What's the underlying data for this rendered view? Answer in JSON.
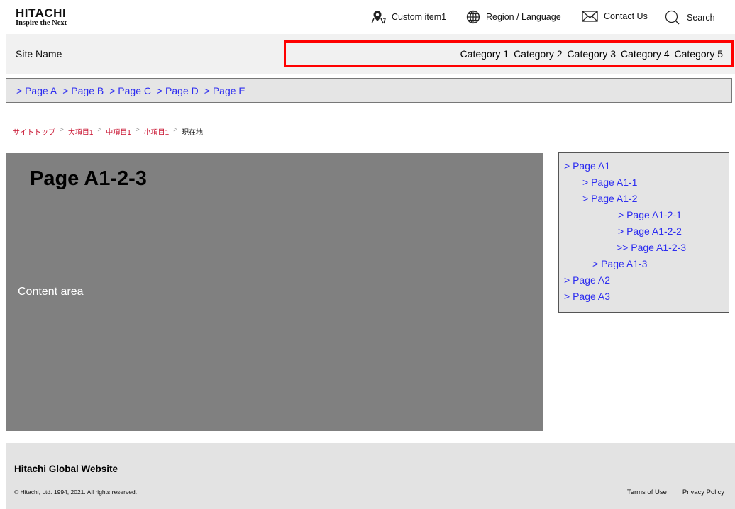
{
  "header": {
    "logo_main": "HITACHI",
    "logo_sub": "Inspire the Next",
    "utility": {
      "custom_item": "Custom item1",
      "region": "Region / Language",
      "contact": "Contact Us",
      "search": "Search"
    },
    "icons": [
      "map-pin-icon",
      "globe-icon",
      "envelope-icon",
      "search-icon"
    ]
  },
  "sitebar": {
    "site_name": "Site Name",
    "categories": [
      "Category 1",
      "Category 2",
      "Category 3",
      "Category 4",
      "Category 5"
    ],
    "highlight_color": "#ff0000"
  },
  "subnav": {
    "items": [
      "> Page A",
      "> Page B",
      "> Page C",
      "> Page D",
      "> Page E"
    ],
    "link_color": "#2d2df0"
  },
  "breadcrumb": {
    "items": [
      "サイトトップ",
      "大項目1",
      "中項目1",
      "小項目1"
    ],
    "separator": ">",
    "current": "現在地",
    "link_color": "#c8102e"
  },
  "content": {
    "title": "Page A1-2-3",
    "label": "Content area",
    "background": "#808080"
  },
  "sidenav": {
    "items": [
      {
        "label": "> Page A1",
        "level": 0
      },
      {
        "label": "> Page A1-1",
        "level": 1
      },
      {
        "label": "> Page A1-2",
        "level": 1
      },
      {
        "label": "> Page A1-2-1",
        "level": 2
      },
      {
        "label": "> Page A1-2-2",
        "level": 2
      },
      {
        "label": ">> Page A1-2-3",
        "level": 2
      },
      {
        "label": "> Page A1-3",
        "level": 1
      },
      {
        "label": "> Page A2",
        "level": 0
      },
      {
        "label": "> Page A3",
        "level": 0
      }
    ]
  },
  "footer": {
    "title": "Hitachi Global Website",
    "copyright": "© Hitachi, Ltd. 1994, 2021. All rights reserved.",
    "links": [
      "Terms of Use",
      "Privacy Policy"
    ]
  }
}
